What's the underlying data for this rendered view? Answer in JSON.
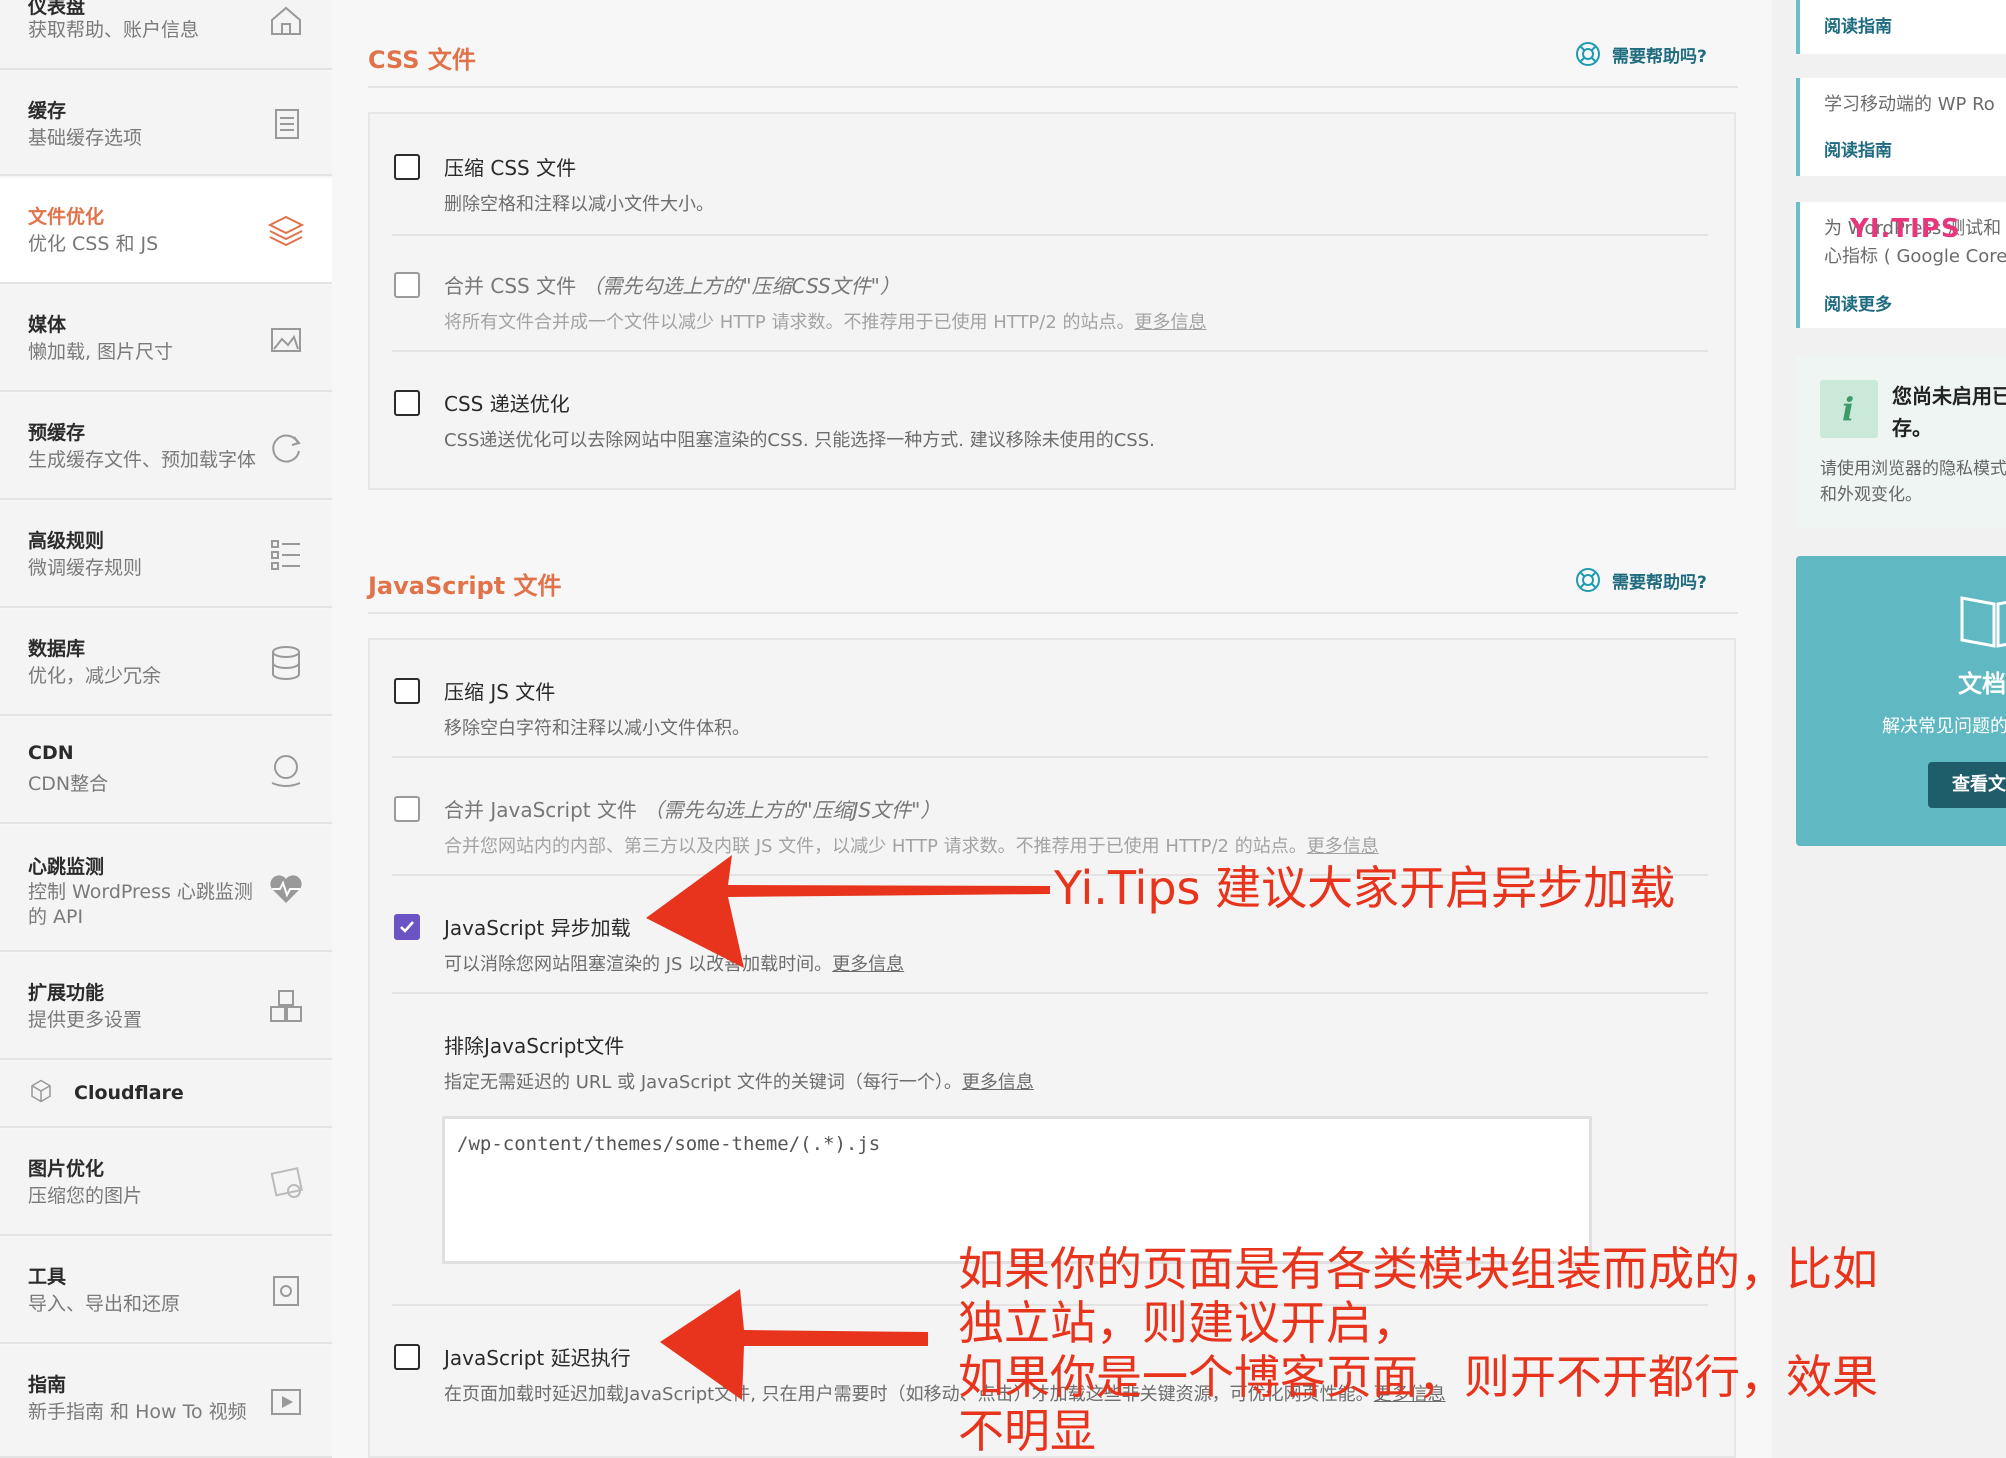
{
  "sidebar": {
    "items": [
      {
        "title": "仪表盘",
        "sub": "获取帮助、账户信息",
        "icon": "home-icon"
      },
      {
        "title": "缓存",
        "sub": "基础缓存选项",
        "icon": "file-icon"
      },
      {
        "title": "文件优化",
        "sub": "优化 CSS 和 JS",
        "icon": "layers-icon",
        "active": true
      },
      {
        "title": "媒体",
        "sub": "懒加载, 图片尺寸",
        "icon": "image-icon"
      },
      {
        "title": "预缓存",
        "sub": "生成缓存文件、预加载字体",
        "icon": "refresh-icon"
      },
      {
        "title": "高级规则",
        "sub": "微调缓存规则",
        "icon": "list-icon"
      },
      {
        "title": "数据库",
        "sub": "优化，减少冗余",
        "icon": "database-icon"
      },
      {
        "title": "CDN",
        "sub": "CDN整合",
        "icon": "globe-icon"
      },
      {
        "title": "心跳监测",
        "sub": "控制 WordPress 心跳监测的 API",
        "icon": "heartbeat-icon"
      },
      {
        "title": "扩展功能",
        "sub": "提供更多设置",
        "icon": "cubes-icon"
      },
      {
        "title": "Cloudflare",
        "sub": "",
        "icon": "cloudflare-icon"
      },
      {
        "title": "图片优化",
        "sub": "压缩您的图片",
        "icon": "imagify-icon"
      },
      {
        "title": "工具",
        "sub": "导入、导出和还原",
        "icon": "tools-icon"
      },
      {
        "title": "指南",
        "sub": "新手指南 和 How To 视频",
        "icon": "video-icon"
      }
    ]
  },
  "css_section": {
    "title": "CSS 文件",
    "help": "需要帮助吗?",
    "options": [
      {
        "label": "压缩 CSS 文件",
        "note": "",
        "desc": "删除空格和注释以减小文件大小。",
        "link": "",
        "checked": false,
        "dim": false
      },
      {
        "label": "合并 CSS 文件",
        "note": "（需先勾选上方的\"压缩CSS文件\"）",
        "desc": "将所有文件合并成一个文件以减少 HTTP 请求数。不推荐用于已使用 HTTP/2 的站点。",
        "link": "更多信息",
        "checked": false,
        "dim": true
      },
      {
        "label": "CSS 递送优化",
        "note": "",
        "desc": "CSS递送优化可以去除网站中阻塞渲染的CSS. 只能选择一种方式. 建议移除未使用的CSS.",
        "link": "",
        "checked": false,
        "dim": false
      }
    ]
  },
  "js_section": {
    "title": "JavaScript 文件",
    "help": "需要帮助吗?",
    "options": [
      {
        "label": "压缩 JS 文件",
        "note": "",
        "desc": "移除空白字符和注释以减小文件体积。",
        "link": "",
        "checked": false,
        "dim": false
      },
      {
        "label": "合并 JavaScript 文件",
        "note": "（需先勾选上方的\"压缩JS文件\"）",
        "desc": "合并您网站内的内部、第三方以及内联 JS 文件，以减少 HTTP 请求数。不推荐用于已使用 HTTP/2 的站点。",
        "link": "更多信息",
        "checked": false,
        "dim": true
      },
      {
        "label": "JavaScript 异步加载",
        "note": "",
        "desc": "可以消除您网站阻塞渲染的 JS 以改善加载时间。",
        "link": "更多信息",
        "checked": true,
        "dim": false
      }
    ],
    "exclude": {
      "label": "排除JavaScript文件",
      "desc": "指定无需延迟的 URL 或 JavaScript 文件的关键词（每行一个）。",
      "link": "更多信息",
      "value": "/wp-content/themes/some-theme/(.*).js"
    },
    "delay": {
      "label": "JavaScript 延迟执行",
      "desc": "在页面加载时延迟加载JavaScript文件, 只在用户需要时（如移动、点击）才加载这些非关键资源，可优化网页性能。",
      "link": "更多信息",
      "checked": false
    }
  },
  "right_panel": {
    "card1_link": "阅读指南",
    "card2_text": "学习移动端的 WP Ro",
    "card2_link": "阅读指南",
    "card3_text1": "为 WordPress 测试和",
    "card3_text2": "心指标 ( Google Core",
    "card3_link": "阅读更多",
    "notice_title1": "您尚未启用已",
    "notice_title2": "存。",
    "notice_text1": "请使用浏览器的隐私模式",
    "notice_text2": "和外观变化。",
    "doc_title": "文档",
    "doc_text": "解决常见问题的",
    "doc_button": "查看文"
  },
  "watermark": "YI.TIPS",
  "annotations": {
    "a1": "Yi.Tips 建议大家开启异步加载",
    "a2_line1": "如果你的页面是有各类模块组装而成的，比如",
    "a2_line2": "独立站，则建议开启，",
    "a2_line3": "如果你是一个博客页面，则开不开都行，效果",
    "a2_line4": "不明显"
  },
  "colors": {
    "accent": "#e0734a",
    "link": "#1f6b80",
    "check": "#6b53c4",
    "annotation": "#e8341c",
    "teal": "#5fb8c2"
  }
}
